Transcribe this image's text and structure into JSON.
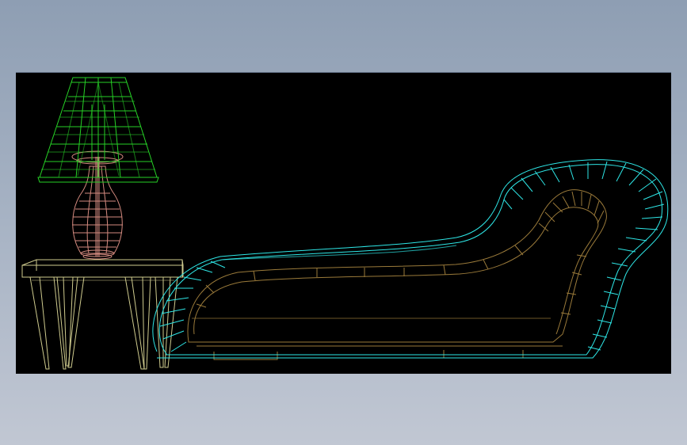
{
  "window": {
    "background": "#97a5b9"
  },
  "viewport": {
    "background": "#000000",
    "content": "wireframe-render"
  },
  "colors": {
    "lampshade": "#26d126",
    "lamp_base": "#d48a7f",
    "table": "#cfcb8e",
    "sofa_outer": "#2ee6e6",
    "sofa_inner": "#9a7a3a"
  }
}
